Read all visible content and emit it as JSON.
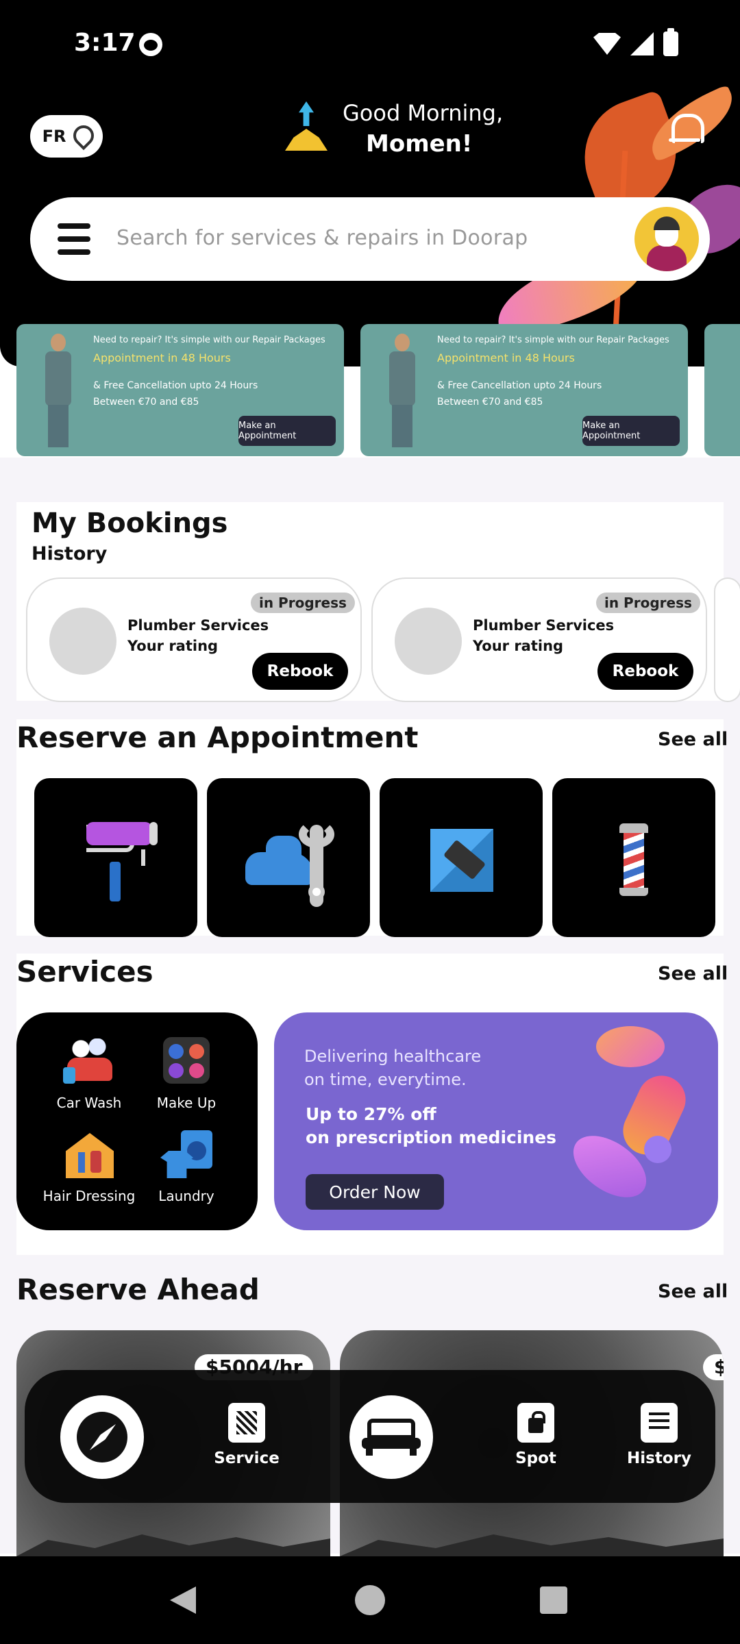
{
  "status": {
    "time": "3:17"
  },
  "header": {
    "location_code": "FR",
    "greeting": "Good Morning,",
    "user_name": "Momen!",
    "search_placeholder": "Search for services & repairs in Doorap"
  },
  "banners": [
    {
      "line1": "Need to repair? It's simple with our Repair Packages",
      "line2": "Appointment in 48 Hours",
      "line3": "& Free Cancellation upto 24 Hours",
      "line4": "Between €70 and €85",
      "button": "Make an Appointment"
    },
    {
      "line1": "Need to repair? It's simple with our Repair Packages",
      "line2": "Appointment in 48 Hours",
      "line3": "& Free Cancellation upto 24 Hours",
      "line4": "Between €70 and €85",
      "button": "Make an Appointment"
    }
  ],
  "bookings": {
    "title": "My Bookings",
    "subtitle": "History",
    "cards": [
      {
        "status": "in Progress",
        "service": "Plumber Services",
        "rating_label": "Your rating",
        "button": "Rebook"
      },
      {
        "status": "in Progress",
        "service": "Plumber Services",
        "rating_label": "Your rating",
        "button": "Rebook"
      }
    ]
  },
  "appointment": {
    "title": "Reserve an Appointment",
    "see_all": "See all",
    "tiles": [
      "paint-roller-icon",
      "car-repair-icon",
      "tool-icon",
      "barber-pole-icon"
    ]
  },
  "services": {
    "title": "Services",
    "see_all": "See all",
    "items": [
      {
        "label": "Car Wash",
        "icon": "car-wash-icon"
      },
      {
        "label": "Make Up",
        "icon": "make-up-icon"
      },
      {
        "label": "Hair Dressing",
        "icon": "hair-dressing-icon"
      },
      {
        "label": "Laundry",
        "icon": "laundry-icon"
      }
    ],
    "promo": {
      "line1": "Delivering healthcare",
      "line2": "on time, everytime.",
      "line3": "Up to 27% off",
      "line4": "on prescription medicines",
      "button": "Order Now"
    }
  },
  "reserve_ahead": {
    "title": "Reserve Ahead",
    "see_all": "See all",
    "price": "$5004/hr",
    "price2": "$"
  },
  "bottom_nav": {
    "items": [
      {
        "label": "",
        "icon": "compass-icon"
      },
      {
        "label": "Service",
        "icon": "service-icon"
      },
      {
        "label": "",
        "icon": "bed-icon"
      },
      {
        "label": "Spot",
        "icon": "spot-icon"
      },
      {
        "label": "History",
        "icon": "history-icon"
      }
    ]
  },
  "colors": {
    "header_bg": "#000000",
    "banner_bg": "#6ba39d",
    "promo_bg": "#7a66d0",
    "accent_yellow": "#f2c537"
  }
}
